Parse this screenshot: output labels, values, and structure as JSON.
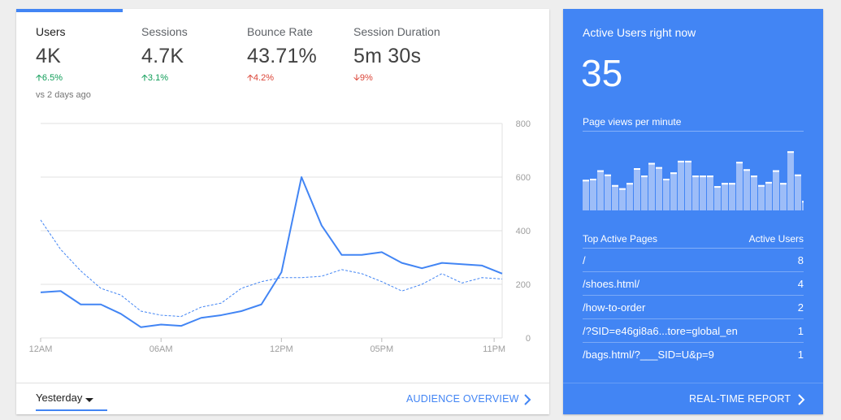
{
  "metrics": [
    {
      "label": "Users",
      "value": "4K",
      "change": "6.5%",
      "direction": "up",
      "tone": "good"
    },
    {
      "label": "Sessions",
      "value": "4.7K",
      "change": "3.1%",
      "direction": "up",
      "tone": "good"
    },
    {
      "label": "Bounce Rate",
      "value": "43.71%",
      "change": "4.2%",
      "direction": "up",
      "tone": "bad"
    },
    {
      "label": "Session Duration",
      "value": "5m 30s",
      "change": "9%",
      "direction": "down",
      "tone": "bad"
    }
  ],
  "compare_note": "vs 2 days ago",
  "chart_data": {
    "type": "line",
    "x": [
      0,
      1,
      2,
      3,
      4,
      5,
      6,
      7,
      8,
      9,
      10,
      11,
      12,
      13,
      14,
      15,
      16,
      17,
      18,
      19,
      20,
      21,
      22,
      23
    ],
    "x_tick_labels": [
      "12AM",
      "06AM",
      "12PM",
      "05PM",
      "11PM"
    ],
    "x_tick_positions": [
      0,
      6,
      12,
      17,
      22.6
    ],
    "y_ticks": [
      800,
      600,
      400,
      200,
      0
    ],
    "ylim": [
      0,
      800
    ],
    "y_axis_side": "right",
    "grid": true,
    "series": [
      {
        "style": "solid",
        "color": "#4285f4",
        "values": [
          170,
          175,
          125,
          125,
          90,
          40,
          50,
          45,
          75,
          85,
          100,
          125,
          245,
          600,
          420,
          310,
          310,
          320,
          280,
          260,
          280,
          275,
          270,
          240
        ]
      },
      {
        "style": "dashed",
        "color": "#4285f4",
        "values": [
          440,
          330,
          250,
          185,
          160,
          100,
          85,
          80,
          115,
          130,
          185,
          210,
          225,
          225,
          230,
          255,
          240,
          210,
          175,
          200,
          240,
          205,
          225,
          220
        ]
      }
    ]
  },
  "footer": {
    "date_range": "Yesterday",
    "audience_link": "AUDIENCE OVERVIEW"
  },
  "realtime": {
    "title": "Active Users right now",
    "count": "35",
    "subtitle": "Page views per minute",
    "page_views_per_minute": [
      29,
      30,
      38,
      34,
      24,
      21,
      26,
      40,
      33,
      45,
      41,
      30,
      36,
      47,
      47,
      33,
      33,
      33,
      23,
      26,
      26,
      46,
      39,
      33,
      24,
      27,
      38,
      26,
      56,
      34,
      9
    ],
    "columns_left": "Top Active Pages",
    "columns_right": "Active Users",
    "rows": [
      {
        "page": "/",
        "users": "8"
      },
      {
        "page": "/shoes.html/",
        "users": "4"
      },
      {
        "page": "/how-to-order",
        "users": "2"
      },
      {
        "page": "/?SID=e46gi8a6...tore=global_en",
        "users": "1"
      },
      {
        "page": "/bags.html/?___SID=U&p=9",
        "users": "1"
      }
    ],
    "report_link": "REAL-TIME REPORT"
  },
  "colors": {
    "accent": "#4285f4",
    "positive": "#0f9d58",
    "negative": "#db4437",
    "gridline": "#e0e0e0"
  }
}
